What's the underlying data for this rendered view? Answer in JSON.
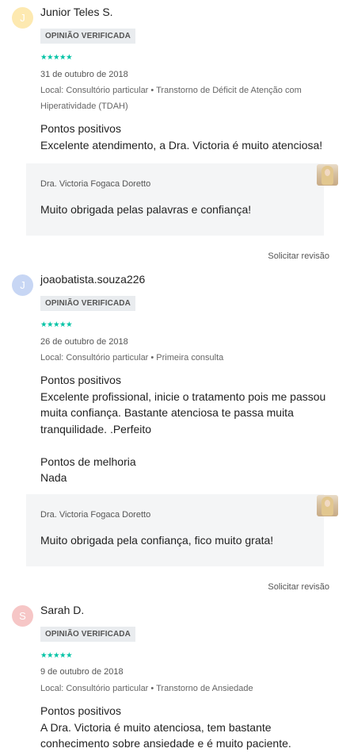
{
  "reviews": [
    {
      "initial": "J",
      "avatar_color": "#fde9b0",
      "author": "Junior Teles S.",
      "badge": "OPINIÃO VERIFICADA",
      "stars": "★★★★★",
      "date": "31 de outubro de 2018",
      "local": "Local: Consultório particular • Transtorno de Déficit de Atenção com Hiperatividade (TDAH)",
      "body": "Pontos positivos\nExcelente atendimento, a Dra. Victoria é muito atenciosa!",
      "reply_name": "Dra. Victoria Fogaca Doretto",
      "reply_text": "Muito obrigada pelas palavras e confiança!",
      "revision": "Solicitar revisão"
    },
    {
      "initial": "J",
      "avatar_color": "#c7d6f4",
      "author": "joaobatista.souza226",
      "badge": "OPINIÃO VERIFICADA",
      "stars": "★★★★★",
      "date": "26 de outubro de 2018",
      "local": "Local: Consultório particular • Primeira consulta",
      "body": "Pontos positivos\nExcelente profissional, inicie o tratamento pois me passou muita confiança. Bastante atenciosa te passa muita tranquilidade. .Perfeito\n\nPontos de melhoria\nNada",
      "reply_name": "Dra. Victoria Fogaca Doretto",
      "reply_text": "Muito obrigada pela confiança, fico muito grata!",
      "revision": "Solicitar revisão"
    },
    {
      "initial": "S",
      "avatar_color": "#f6c6c6",
      "author": "Sarah D.",
      "badge": "OPINIÃO VERIFICADA",
      "stars": "★★★★★",
      "date": "9 de outubro de 2018",
      "local": "Local: Consultório particular • Transtorno de Ansiedade",
      "body": "Pontos positivos\nA Dra. Victoria é muito atenciosa, tem bastante conhecimento sobre ansiedade e é muito paciente."
    }
  ]
}
